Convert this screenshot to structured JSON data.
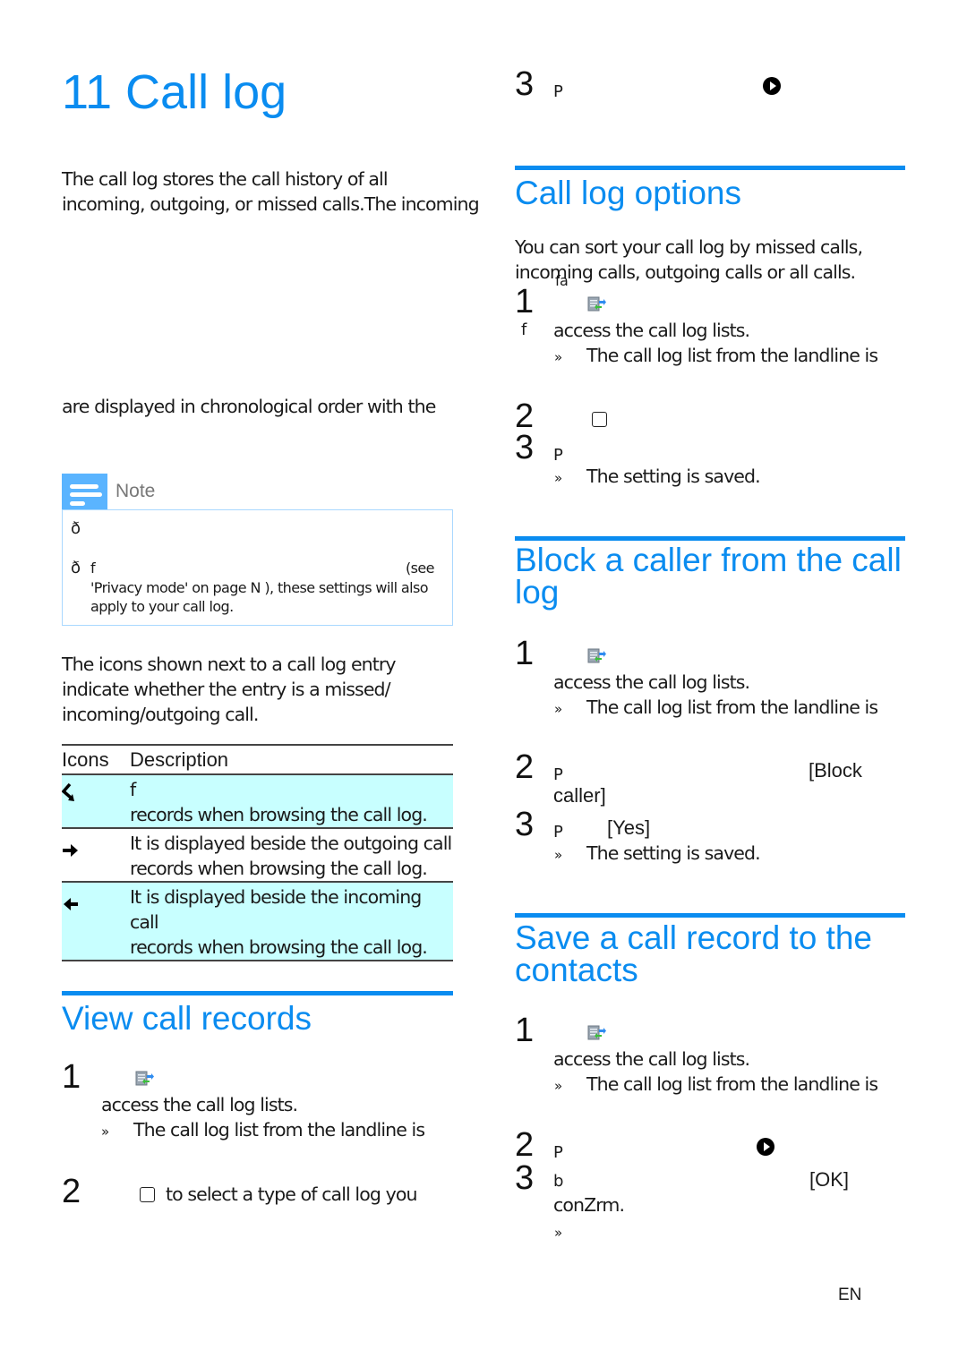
{
  "page": {
    "chapter_title": "11 Call log",
    "footer_lang": "EN"
  },
  "left": {
    "intro_line1": "The call log stores the call history of all",
    "intro_line2": "incoming, outgoing, or missed calls.The incoming",
    "intro_line3": "are displayed in chronological order with the",
    "note": {
      "label": "Note",
      "bullet1_marker": "ð",
      "bullet2_marker": "ð",
      "bullet2_char": "f",
      "bullet2_see": "(see",
      "bullet2_line2": "'Privacy mode' on page N ), these settings will also",
      "bullet2_line3": "apply to your call log."
    },
    "icons_intro_line1": "The icons shown next to a call log entry",
    "icons_intro_line2": "indicate whether the entry is a missed/",
    "icons_intro_line3": "incoming/outgoing call.",
    "table": {
      "headers": [
        "Icons",
        "Description"
      ],
      "rows": [
        {
          "icon": "missed-call-icon",
          "line1": "f",
          "line2": "records when browsing the call log."
        },
        {
          "icon": "outgoing-call-icon",
          "line1": "It is displayed beside the outgoing call",
          "line2": "records when browsing the call log."
        },
        {
          "icon": "incoming-call-icon",
          "line1": "It is displayed beside the incoming call",
          "line2": "records when browsing the call log."
        }
      ]
    },
    "view_section": {
      "title": "View call records",
      "step1_num": "1",
      "step1_line2": "access the call log lists.",
      "step1_result_marker": "»",
      "step1_result": "The call log list from the landline is",
      "step2_num": "2",
      "step2_text": "to select a type of call log you"
    }
  },
  "right": {
    "top_step": {
      "num": "3",
      "text": "P"
    },
    "options_section": {
      "title": "Call log options",
      "intro_line1": "You can sort your call log by missed calls,",
      "intro_line2": "incoming calls, outgoing calls or all calls.",
      "overlap_glyph": "ſa",
      "step1_num": "1",
      "step1_marker": "f",
      "step1_line2": "access the call log lists.",
      "step1_result_marker": "»",
      "step1_result": "The call log list from the landline is",
      "step2_num": "2",
      "step3_num": "3",
      "step3_text": "P",
      "step3_result_marker": "»",
      "step3_result": "The setting is saved."
    },
    "block_section": {
      "title_line1": "Block a caller from the call",
      "title_line2": "log",
      "step1_num": "1",
      "step1_line2": "access the call log lists.",
      "step1_result_marker": "»",
      "step1_result": "The call log list from the landline is",
      "step2_num": "2",
      "step2_text": "P",
      "step2_option": "[Block",
      "step2_line2": "caller]",
      "step3_num": "3",
      "step3_text": "P",
      "step3_option": "[Yes]",
      "step3_result_marker": "»",
      "step3_result": "The setting is saved."
    },
    "save_section": {
      "title_line1": "Save a call record to the",
      "title_line2": "contacts",
      "step1_num": "1",
      "step1_line2": "access the call log lists.",
      "step1_result_marker": "»",
      "step1_result": "The call log list from the landline is",
      "step2_num": "2",
      "step2_text": "P",
      "step3_num": "3",
      "step3_text": "b",
      "step3_option": "[OK]",
      "step3_line2": "conZrm.",
      "step3_result_marker": "»"
    }
  },
  "colors": {
    "heading_blue": "#0a8cf0",
    "note_blue": "#5ab4ff",
    "note_border": "#a9d8ff",
    "table_shade": "#c8ffff"
  }
}
